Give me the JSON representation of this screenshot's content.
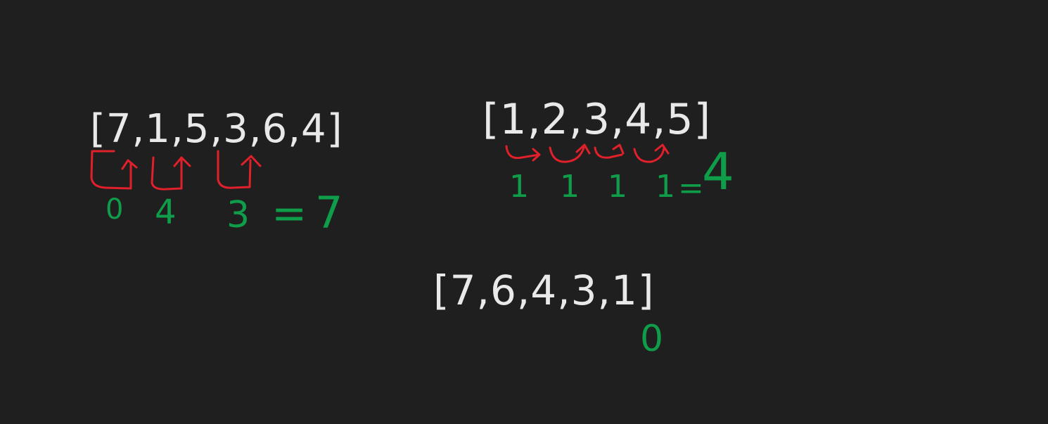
{
  "colors": {
    "background": "#1f1f1f",
    "array_ink": "#e9e9e9",
    "arrow_ink": "#e0202a",
    "result_ink": "#0f9d4a"
  },
  "examples": [
    {
      "array": "[7,1,5,3,6,4]",
      "profits": [
        "0",
        "4",
        "3"
      ],
      "equals": "=",
      "total": "7"
    },
    {
      "array": "[1,2,3,4,5]",
      "profits": [
        "1",
        "1",
        "1",
        "1"
      ],
      "equals": "=",
      "total": "4"
    },
    {
      "array": "[7,6,4,3,1]",
      "total": "0"
    }
  ]
}
